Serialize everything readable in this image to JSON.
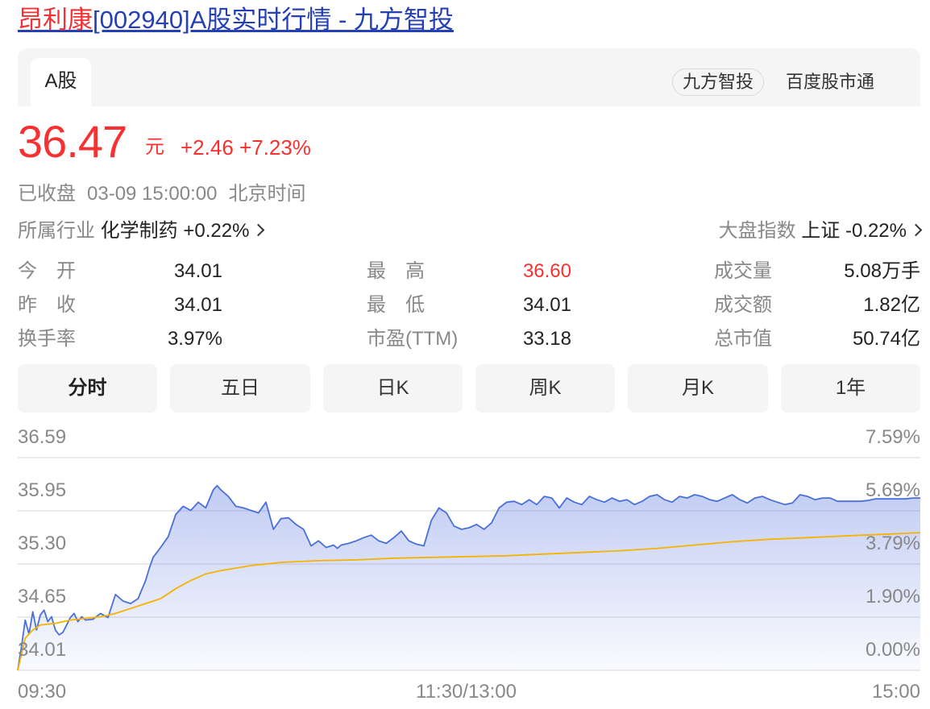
{
  "header": {
    "title_name": "昂利康",
    "title_rest": "[002940]A股实时行情 - 九方智投"
  },
  "tabs": {
    "market_tab": "A股",
    "brand_chip": "九方智投",
    "brand_link": "百度股市通"
  },
  "quote": {
    "price": "36.47",
    "unit": "元",
    "change": "+2.46 +7.23%",
    "status": "已收盘",
    "datetime": "03-09 15:00:00",
    "timezone": "北京时间"
  },
  "industry": {
    "label": "所属行业",
    "name": "化学制药 +0.22%",
    "index_label": "大盘指数",
    "index_value": "上证 -0.22%"
  },
  "stats": [
    {
      "label": "今　开",
      "value": "34.01"
    },
    {
      "label": "昨　收",
      "value": "34.01"
    },
    {
      "label": "换手率",
      "value": "3.97%"
    },
    {
      "label": "最　高",
      "value": "36.60"
    },
    {
      "label": "最　低",
      "value": "34.01"
    },
    {
      "label": "市盈(TTM)",
      "value": "33.18"
    },
    {
      "label": "成交量",
      "value": "5.08万手"
    },
    {
      "label": "成交额",
      "value": "1.82亿"
    },
    {
      "label": "总市值",
      "value": "50.74亿"
    }
  ],
  "range_tabs": [
    "分时",
    "五日",
    "日K",
    "周K",
    "月K",
    "1年"
  ],
  "colors": {
    "up": "#f73131",
    "price_line": "#4a6fd9",
    "avg_line": "#f5b300",
    "grid": "#e4e4e4"
  },
  "chart_data": {
    "type": "area",
    "y_left_ticks": [
      "36.59",
      "35.95",
      "35.30",
      "34.65",
      "34.01"
    ],
    "y_right_ticks": [
      "7.59%",
      "5.69%",
      "3.79%",
      "1.90%",
      "0.00%"
    ],
    "x_ticks": [
      "09:30",
      "11:30/13:00",
      "15:00"
    ],
    "ylim": [
      34.01,
      36.59
    ],
    "x_range_minutes": [
      0,
      240
    ],
    "series": [
      {
        "values_x": [
          0,
          1,
          2,
          3,
          4,
          5,
          6,
          7,
          8,
          9,
          10,
          11,
          12,
          13,
          14,
          15,
          16,
          17,
          18,
          20,
          22,
          24,
          26,
          28,
          30,
          32,
          34,
          35,
          36,
          38,
          40,
          42,
          44,
          46,
          48,
          50,
          52,
          53,
          54,
          56,
          58,
          60,
          62,
          64,
          66,
          68,
          70,
          72,
          74,
          76,
          78,
          80,
          82,
          84,
          85,
          86,
          88,
          90,
          92,
          94,
          96,
          98,
          100,
          102,
          104,
          106,
          108,
          110,
          112,
          114,
          116,
          118,
          120,
          122,
          124,
          126,
          128,
          130,
          132,
          134,
          136,
          138,
          140,
          142,
          144,
          146,
          148,
          150,
          152,
          154,
          156,
          158,
          160,
          162,
          164,
          166,
          168,
          170,
          172,
          174,
          176,
          178,
          180,
          182,
          184,
          186,
          188,
          190,
          192,
          194,
          196,
          198,
          200,
          202,
          204,
          206,
          208,
          210,
          212,
          214,
          216,
          218,
          220,
          222,
          224,
          226,
          228,
          230,
          232,
          234,
          236,
          238,
          240
        ],
        "values": [
          34.01,
          34.3,
          34.62,
          34.45,
          34.72,
          34.5,
          34.68,
          34.74,
          34.6,
          34.66,
          34.5,
          34.44,
          34.47,
          34.56,
          34.65,
          34.7,
          34.6,
          34.66,
          34.62,
          34.63,
          34.7,
          34.65,
          34.93,
          34.85,
          34.82,
          34.88,
          35.1,
          35.25,
          35.38,
          35.5,
          35.63,
          35.9,
          36.0,
          35.95,
          36.05,
          35.98,
          36.2,
          36.25,
          36.2,
          36.12,
          36.0,
          35.98,
          35.95,
          35.92,
          36.05,
          35.72,
          35.85,
          35.86,
          35.78,
          35.72,
          35.52,
          35.58,
          35.5,
          35.53,
          35.49,
          35.53,
          35.55,
          35.58,
          35.62,
          35.65,
          35.58,
          35.55,
          35.62,
          35.7,
          35.58,
          35.54,
          35.52,
          35.83,
          35.98,
          35.92,
          35.76,
          35.72,
          35.74,
          35.78,
          35.72,
          35.8,
          35.98,
          36.05,
          36.06,
          36.02,
          36.08,
          36.02,
          36.12,
          36.1,
          35.98,
          36.1,
          36.05,
          36.02,
          36.12,
          36.08,
          36.05,
          36.1,
          36.06,
          36.08,
          36.02,
          36.06,
          36.12,
          36.14,
          36.08,
          36.05,
          36.12,
          36.1,
          36.14,
          36.12,
          36.08,
          36.06,
          36.1,
          36.14,
          36.08,
          36.04,
          36.1,
          36.12,
          36.08,
          36.05,
          36.02,
          36.04,
          36.14,
          36.12,
          36.08,
          36.1,
          36.1,
          36.06,
          36.06,
          36.06,
          36.06,
          36.07,
          36.09,
          36.09,
          36.09,
          36.09,
          36.09,
          36.1,
          36.1
        ]
      },
      {
        "values_x": [
          0,
          2,
          4,
          6,
          8,
          10,
          14,
          18,
          22,
          26,
          30,
          34,
          38,
          42,
          46,
          50,
          54,
          58,
          62,
          66,
          70,
          80,
          90,
          100,
          110,
          120,
          130,
          140,
          150,
          160,
          170,
          180,
          190,
          200,
          210,
          220,
          230,
          240
        ],
        "values": [
          34.01,
          34.4,
          34.5,
          34.56,
          34.57,
          34.58,
          34.62,
          34.64,
          34.66,
          34.7,
          34.76,
          34.82,
          34.88,
          35.0,
          35.1,
          35.18,
          35.22,
          35.25,
          35.28,
          35.3,
          35.32,
          35.34,
          35.35,
          35.37,
          35.38,
          35.39,
          35.4,
          35.42,
          35.44,
          35.46,
          35.49,
          35.53,
          35.57,
          35.6,
          35.62,
          35.64,
          35.66,
          35.68
        ]
      }
    ],
    "grid": true
  }
}
